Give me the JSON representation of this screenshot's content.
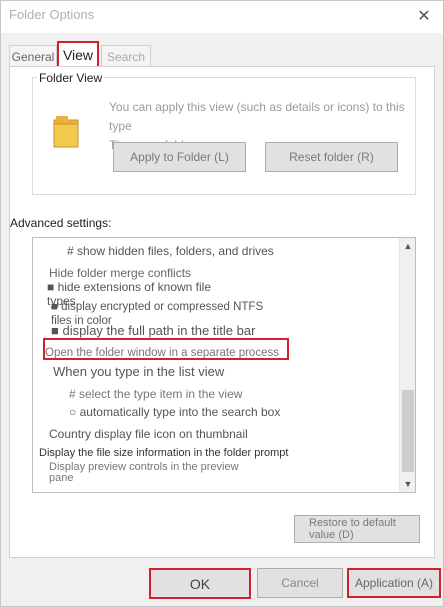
{
  "window": {
    "title": "Folder Options",
    "close_glyph": "✕"
  },
  "tabs": {
    "general": "General",
    "view": "View",
    "search": "Search"
  },
  "folder_view": {
    "legend": "Folder View",
    "description_line1": "You can apply this view (such as details or icons) to this type",
    "description_line2": "There are folders.",
    "apply_button": "Apply to Folder (L)",
    "reset_button": "Reset folder (R)",
    "icon": "folder-icon"
  },
  "advanced": {
    "label": "Advanced settings:",
    "items": [
      {
        "text": "# show hidden files, folders, and drives"
      },
      {
        "text": "Hide folder merge conflicts"
      },
      {
        "text": "■ hide extensions of known file types"
      },
      {
        "text": "■ display encrypted or compressed NTFS files in color"
      },
      {
        "text": "■ display the full path in the title bar"
      },
      {
        "text": "Open the folder window in a separate process"
      },
      {
        "text": "When you type in the list view"
      },
      {
        "text": "# select the type item in the view"
      },
      {
        "text": "○ automatically type into the search box"
      },
      {
        "text": "Country display file icon on thumbnail"
      },
      {
        "text": "Display the file size information in the folder prompt"
      },
      {
        "text": "Display preview controls in the preview pane"
      }
    ],
    "scroll_up_glyph": "▲",
    "scroll_down_glyph": "▼"
  },
  "restore_button": "Restore to default value (D)",
  "footer": {
    "ok": "OK",
    "cancel": "Cancel",
    "apply": "Application (A)"
  },
  "colors": {
    "highlight_red": "#d2202f",
    "folder_yellow": "#f2c94c"
  }
}
